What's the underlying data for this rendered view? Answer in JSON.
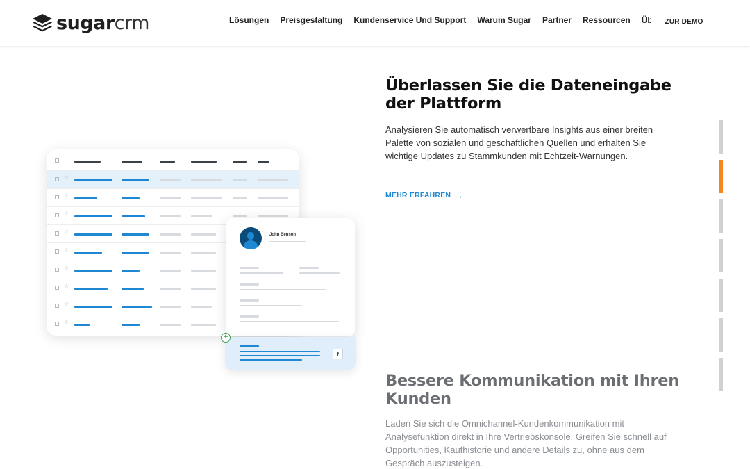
{
  "header": {
    "logo_bold": "sugar",
    "logo_light": "crm",
    "nav": [
      "Lösungen",
      "Preisgestaltung",
      "Kundenservice Und Support",
      "Warum Sugar",
      "Partner",
      "Ressourcen",
      "Über"
    ],
    "demo_label": "ZUR DEMO"
  },
  "illustration": {
    "contact_name": "John Benson",
    "social_icon": "f"
  },
  "section1": {
    "title": "Überlassen Sie die Dateneingabe der Plattform",
    "text": "Analysieren Sie automatisch verwertbare Insights aus einer breiten Palette von sozialen und geschäftlichen Quellen und erhalten Sie wichtige Updates zu Stammkunden mit Echtzeit-Warnungen.",
    "link": "MEHR ERFAHREN",
    "link_arrow": "→"
  },
  "section2": {
    "title": "Bessere Kommunikation mit Ihren Kunden",
    "text": "Laden Sie sich die Omnichannel-Kundenkommunikation mit Analysefunktion direkt in Ihre Vertriebskonsole. Greifen Sie schnell auf Opportunities, Kaufhistorie und andere Details zu, ohne aus dem Gespräch auszusteigen."
  },
  "progress": {
    "total_steps": 7,
    "active_step": 2,
    "active_color": "#f28a1f",
    "inactive_color": "#cfd1d3"
  },
  "colors": {
    "accent_blue": "#1e88d2",
    "highlight_row": "#e4f1fb",
    "plus_green": "#3da14a"
  }
}
